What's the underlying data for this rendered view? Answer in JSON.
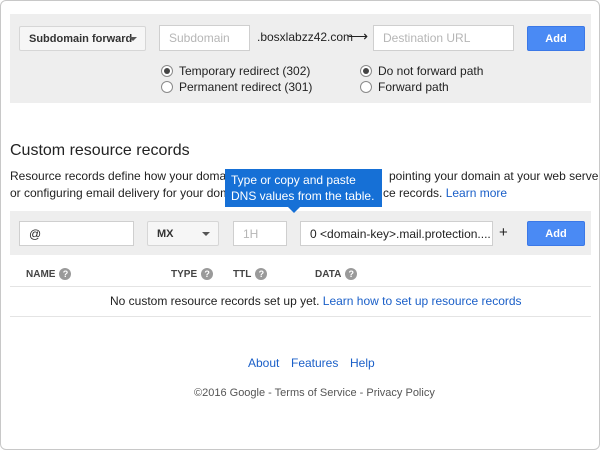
{
  "forwarding": {
    "type_select": "Subdomain forward",
    "subdomain_placeholder": "Subdomain",
    "domain_suffix": ".bosxlabzz42.com",
    "arrow": "⟶",
    "destination_placeholder": "Destination URL",
    "add_label": "Add",
    "redirect_options": [
      {
        "label": "Temporary redirect (302)",
        "selected": true
      },
      {
        "label": "Permanent redirect (301)",
        "selected": false
      }
    ],
    "path_options": [
      {
        "label": "Do not forward path",
        "selected": true
      },
      {
        "label": "Forward path",
        "selected": false
      }
    ]
  },
  "records": {
    "title": "Custom resource records",
    "desc_line1_a": "Resource records define how your domain",
    "desc_line1_b": "pointing your domain at your web server",
    "desc_line2_a": "or configuring email delivery for your doma",
    "desc_line2_b": "ce records.",
    "learn_more": "Learn more",
    "tooltip": "Type or copy and paste DNS values from the table.",
    "name_value": "@",
    "type_value": "MX",
    "ttl_placeholder": "1H",
    "data_value": "0 <domain-key>.mail.protection....",
    "plus": "+",
    "add_label": "Add",
    "columns": [
      "NAME",
      "TYPE",
      "TTL",
      "DATA"
    ],
    "help_glyph": "?",
    "empty_message": "No custom resource records set up yet.",
    "empty_link": "Learn how to set up resource records"
  },
  "footer": {
    "links": [
      "About",
      "Features",
      "Help"
    ],
    "copyright": "©2016 Google - Terms of Service - Privacy Policy"
  },
  "colors": {
    "accent": "#4a8af4",
    "tooltip": "#1670d6",
    "link": "#1a5fc8",
    "panel": "#eeeeee"
  }
}
